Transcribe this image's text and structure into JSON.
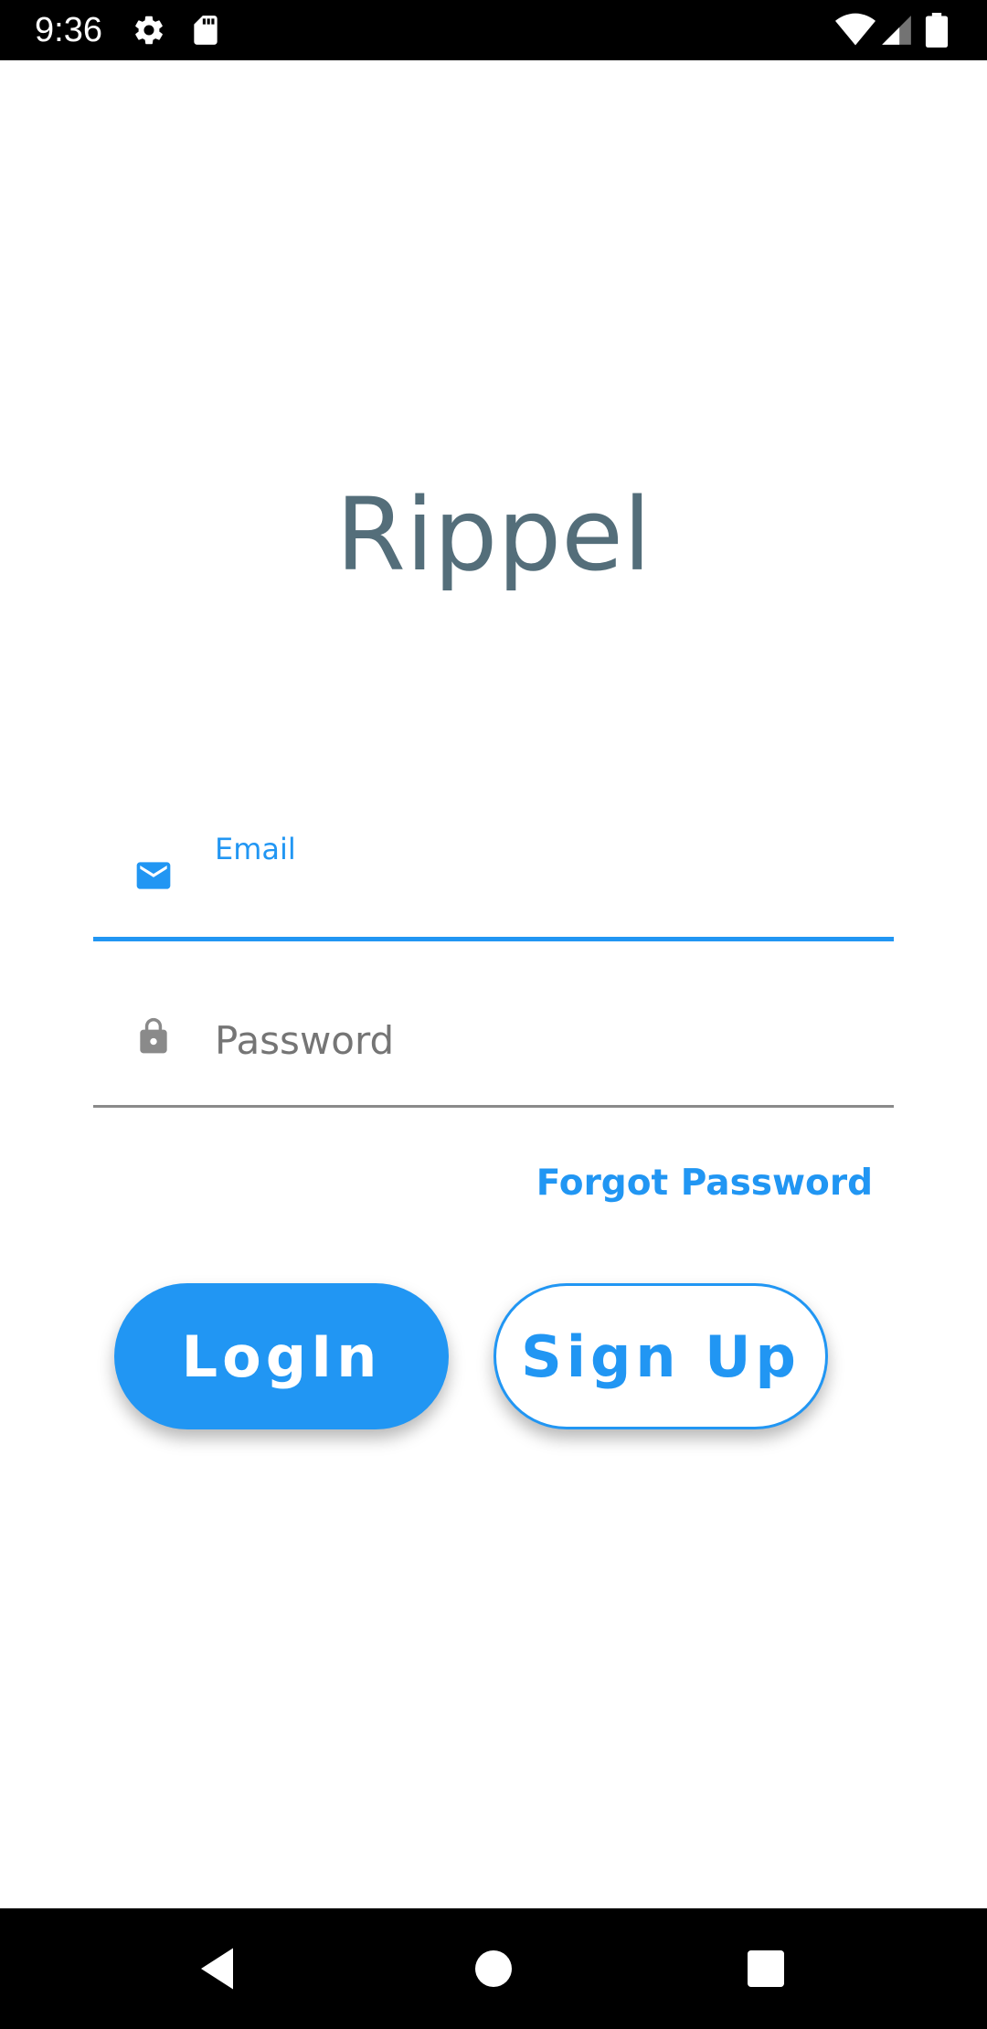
{
  "status_bar": {
    "time": "9:36",
    "left_icons": [
      "gear-icon",
      "sd-card-icon"
    ],
    "right_icons": [
      "wifi-icon",
      "signal-icon",
      "battery-icon"
    ]
  },
  "app": {
    "title": "Rippel"
  },
  "email_field": {
    "label": "Email",
    "value": "",
    "icon": "mail-icon",
    "state": "focused"
  },
  "password_field": {
    "placeholder": "Password",
    "value": "",
    "icon": "lock-icon"
  },
  "links": {
    "forgot_password": "Forgot Password"
  },
  "buttons": {
    "login": "LogIn",
    "signup": "Sign Up"
  },
  "nav_bar": {
    "icons": [
      "back-icon",
      "home-icon",
      "recents-icon"
    ]
  },
  "colors": {
    "accent": "#2196f3",
    "title": "#546e7a",
    "bars": "#000000",
    "inactive_icon": "#8a8a8a"
  }
}
